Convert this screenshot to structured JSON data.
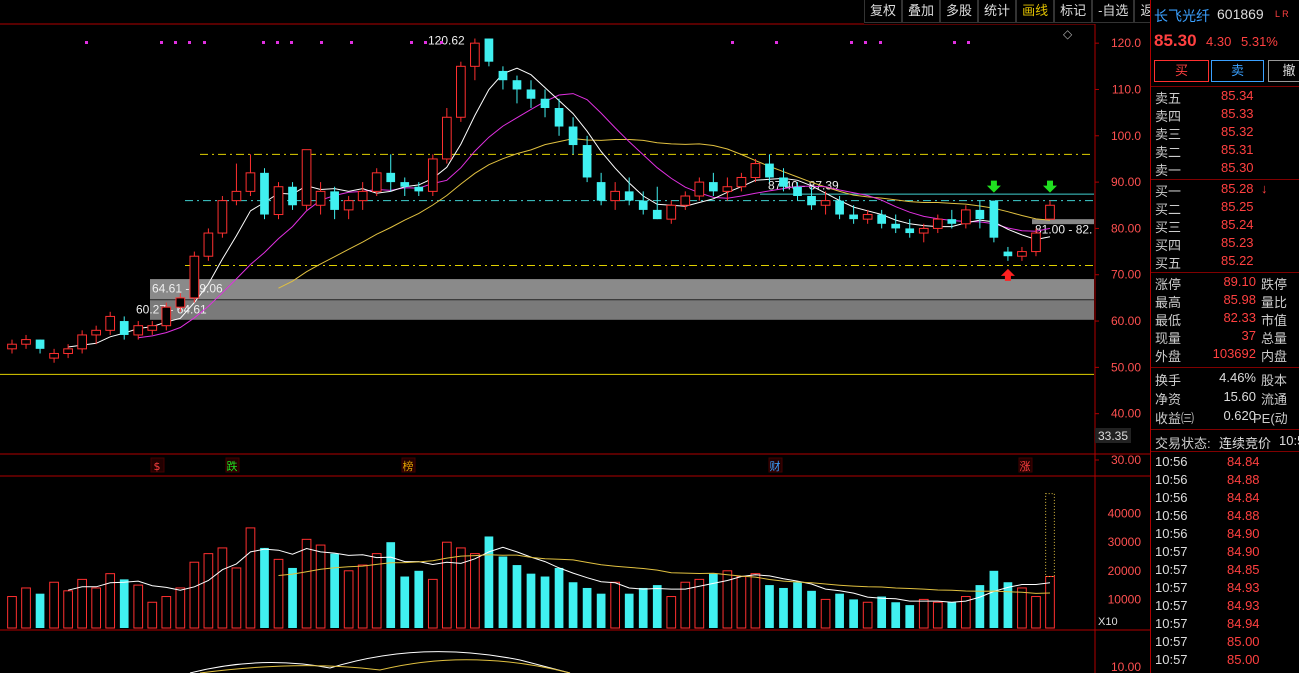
{
  "toolbar": {
    "items": [
      "复权",
      "叠加",
      "多股",
      "统计",
      "画线",
      "标记",
      "-自选",
      "返回"
    ],
    "active": "画线"
  },
  "stock": {
    "name": "长飞光纤",
    "code": "601869",
    "tag": "L R",
    "price": "85.30",
    "change": "4.30",
    "change_pct": "5.31%"
  },
  "trade_buttons": {
    "buy": "买",
    "sell": "卖",
    "cancel": "撤"
  },
  "order_book": {
    "asks": [
      {
        "label": "卖五",
        "price": "85.34"
      },
      {
        "label": "卖四",
        "price": "85.33"
      },
      {
        "label": "卖三",
        "price": "85.32"
      },
      {
        "label": "卖二",
        "price": "85.31"
      },
      {
        "label": "卖一",
        "price": "85.30"
      }
    ],
    "bids": [
      {
        "label": "买一",
        "price": "85.28",
        "arrow": "↓"
      },
      {
        "label": "买二",
        "price": "85.25"
      },
      {
        "label": "买三",
        "price": "85.24"
      },
      {
        "label": "买四",
        "price": "85.23"
      },
      {
        "label": "买五",
        "price": "85.22"
      }
    ]
  },
  "stats": [
    {
      "label": "涨停",
      "value": "89.10",
      "label2": "跌停"
    },
    {
      "label": "最高",
      "value": "85.98",
      "label2": "量比"
    },
    {
      "label": "最低",
      "value": "82.33",
      "label2": "市值"
    },
    {
      "label": "现量",
      "value": "37",
      "label2": "总量"
    },
    {
      "label": "外盘",
      "value": "103692",
      "label2": "内盘"
    }
  ],
  "stats2": [
    {
      "label": "换手",
      "value": "4.46%",
      "label2": "股本"
    },
    {
      "label": "净资",
      "value": "15.60",
      "label2": "流通"
    },
    {
      "label": "收益㈢",
      "value": "0.620",
      "label2": "PE(动"
    }
  ],
  "trade_status": {
    "label": "交易状态:",
    "value": "连续竞价",
    "time": "10:5"
  },
  "ticks": [
    {
      "time": "10:56",
      "price": "84.84"
    },
    {
      "time": "10:56",
      "price": "84.88"
    },
    {
      "time": "10:56",
      "price": "84.84"
    },
    {
      "time": "10:56",
      "price": "84.88"
    },
    {
      "time": "10:56",
      "price": "84.90"
    },
    {
      "time": "10:57",
      "price": "84.90"
    },
    {
      "time": "10:57",
      "price": "84.85"
    },
    {
      "time": "10:57",
      "price": "84.93"
    },
    {
      "time": "10:57",
      "price": "84.93"
    },
    {
      "time": "10:57",
      "price": "84.94"
    },
    {
      "time": "10:57",
      "price": "85.00"
    },
    {
      "time": "10:57",
      "price": "85.00"
    }
  ],
  "chart_labels": {
    "price_axis": [
      "120.0",
      "110.0",
      "100.0",
      "90.00",
      "80.00",
      "70.00",
      "60.00",
      "50.00",
      "40.00",
      "30.00"
    ],
    "current_price_tag": "33.35",
    "vol_axis": [
      "40000",
      "30000",
      "20000",
      "10000"
    ],
    "vol_unit": "X10",
    "lower_axis": [
      "10.00"
    ],
    "high_label": "120.62",
    "zone1_label": "64.61 - 69.06",
    "zone2_label": "60.27 - 64.61",
    "zone3_label": "87.40 - 87.39",
    "zone4_label": "81.00 - 82.",
    "event_markers": [
      {
        "text": "$",
        "color": "#ff4040"
      },
      {
        "text": "跌",
        "color": "#20e020"
      },
      {
        "text": "榜",
        "color": "#e0a000"
      },
      {
        "text": "财",
        "color": "#3aa0ff"
      },
      {
        "text": "涨",
        "color": "#ff4040"
      }
    ]
  },
  "colors": {
    "up": "#ff3030",
    "down": "#40f0f0",
    "ma5": "#ffffff",
    "ma10": "#e030e0",
    "ma20": "#e0c040",
    "grid_red": "#b00000"
  },
  "chart_data": {
    "type": "candlestick",
    "ylim": [
      30,
      125
    ],
    "volume_ylim": [
      0,
      50000
    ],
    "candles": [
      [
        54,
        56,
        53,
        55
      ],
      [
        55,
        57,
        54,
        56
      ],
      [
        56,
        56,
        53,
        54
      ],
      [
        52,
        54,
        51,
        53
      ],
      [
        53,
        55,
        52,
        54
      ],
      [
        54,
        58,
        53,
        57
      ],
      [
        57,
        59,
        55,
        58
      ],
      [
        58,
        62,
        57,
        61
      ],
      [
        60,
        61,
        56,
        57
      ],
      [
        57,
        60,
        56,
        59
      ],
      [
        58,
        60,
        57,
        59
      ],
      [
        59,
        64,
        58,
        63
      ],
      [
        63,
        66,
        62,
        65
      ],
      [
        65,
        75,
        64,
        74
      ],
      [
        74,
        80,
        73,
        79
      ],
      [
        79,
        87,
        78,
        86
      ],
      [
        86,
        94,
        85,
        88
      ],
      [
        88,
        96,
        87,
        92
      ],
      [
        92,
        93,
        82,
        83
      ],
      [
        83,
        90,
        82,
        89
      ],
      [
        89,
        90,
        84,
        85
      ],
      [
        85,
        97,
        84,
        97
      ],
      [
        85,
        90,
        83,
        88
      ],
      [
        88,
        89,
        82,
        84
      ],
      [
        84,
        87,
        82,
        86
      ],
      [
        86,
        90,
        84,
        88
      ],
      [
        88,
        93,
        87,
        92
      ],
      [
        92,
        96,
        88,
        90
      ],
      [
        90,
        91,
        87,
        89
      ],
      [
        89,
        90,
        87,
        88
      ],
      [
        88,
        96,
        87,
        95
      ],
      [
        95,
        106,
        94,
        104
      ],
      [
        104,
        116,
        103,
        115
      ],
      [
        115,
        121,
        112,
        120
      ],
      [
        121,
        121,
        115,
        116
      ],
      [
        114,
        115,
        110,
        112
      ],
      [
        112,
        113,
        107,
        110
      ],
      [
        110,
        112,
        106,
        108
      ],
      [
        108,
        110,
        104,
        106
      ],
      [
        106,
        108,
        100,
        102
      ],
      [
        102,
        104,
        96,
        98
      ],
      [
        98,
        100,
        90,
        91
      ],
      [
        90,
        92,
        85,
        86
      ],
      [
        86,
        90,
        84,
        88
      ],
      [
        88,
        91,
        85,
        86
      ],
      [
        86,
        88,
        83,
        84
      ],
      [
        84,
        89,
        82,
        82
      ],
      [
        82,
        86,
        81,
        85
      ],
      [
        85,
        88,
        84,
        87
      ],
      [
        87,
        91,
        86,
        90
      ],
      [
        90,
        92,
        87,
        88
      ],
      [
        88,
        91,
        86,
        89
      ],
      [
        89,
        92,
        88,
        91
      ],
      [
        91,
        95,
        90,
        94
      ],
      [
        94,
        96,
        90,
        91
      ],
      [
        91,
        93,
        88,
        89
      ],
      [
        89,
        90,
        86,
        87
      ],
      [
        87,
        89,
        84,
        85
      ],
      [
        85,
        88,
        83,
        86
      ],
      [
        86,
        87,
        82,
        83
      ],
      [
        83,
        85,
        81,
        82
      ],
      [
        82,
        84,
        81,
        83
      ],
      [
        83,
        84,
        80,
        81
      ],
      [
        81,
        83,
        79,
        80
      ],
      [
        80,
        82,
        78,
        79
      ],
      [
        79,
        81,
        77,
        80
      ],
      [
        80,
        83,
        79,
        82
      ],
      [
        82,
        84,
        80,
        81
      ],
      [
        81,
        85,
        80,
        84
      ],
      [
        84,
        86,
        80,
        82
      ],
      [
        86,
        86,
        77,
        78
      ],
      [
        75,
        76,
        73,
        74
      ],
      [
        74,
        76,
        73,
        75
      ],
      [
        75,
        80,
        74,
        79
      ],
      [
        82,
        86,
        82,
        85
      ]
    ],
    "volumes": [
      11000,
      14000,
      12000,
      16000,
      13000,
      17000,
      14000,
      19000,
      17000,
      15000,
      9000,
      11000,
      14000,
      23000,
      26000,
      28000,
      21000,
      35000,
      28000,
      24000,
      21000,
      31000,
      29000,
      26000,
      20000,
      22000,
      26000,
      30000,
      18000,
      20000,
      17000,
      30000,
      28000,
      26000,
      32000,
      25000,
      22000,
      19000,
      18000,
      21000,
      16000,
      14000,
      12000,
      16000,
      12000,
      14000,
      15000,
      11000,
      16000,
      17000,
      19000,
      20000,
      18000,
      19000,
      15000,
      14000,
      16000,
      13000,
      10000,
      12000,
      10000,
      9000,
      11000,
      9000,
      8000,
      10000,
      9000,
      9000,
      11000,
      15000,
      20000,
      16000,
      14000,
      11000,
      18000
    ],
    "markers": [
      {
        "index": 70,
        "type": "down-arrow",
        "color": "#20e020"
      },
      {
        "index": 74,
        "type": "down-arrow",
        "color": "#20e020"
      },
      {
        "index": 71,
        "type": "up-arrow",
        "color": "#ff2020"
      }
    ]
  }
}
